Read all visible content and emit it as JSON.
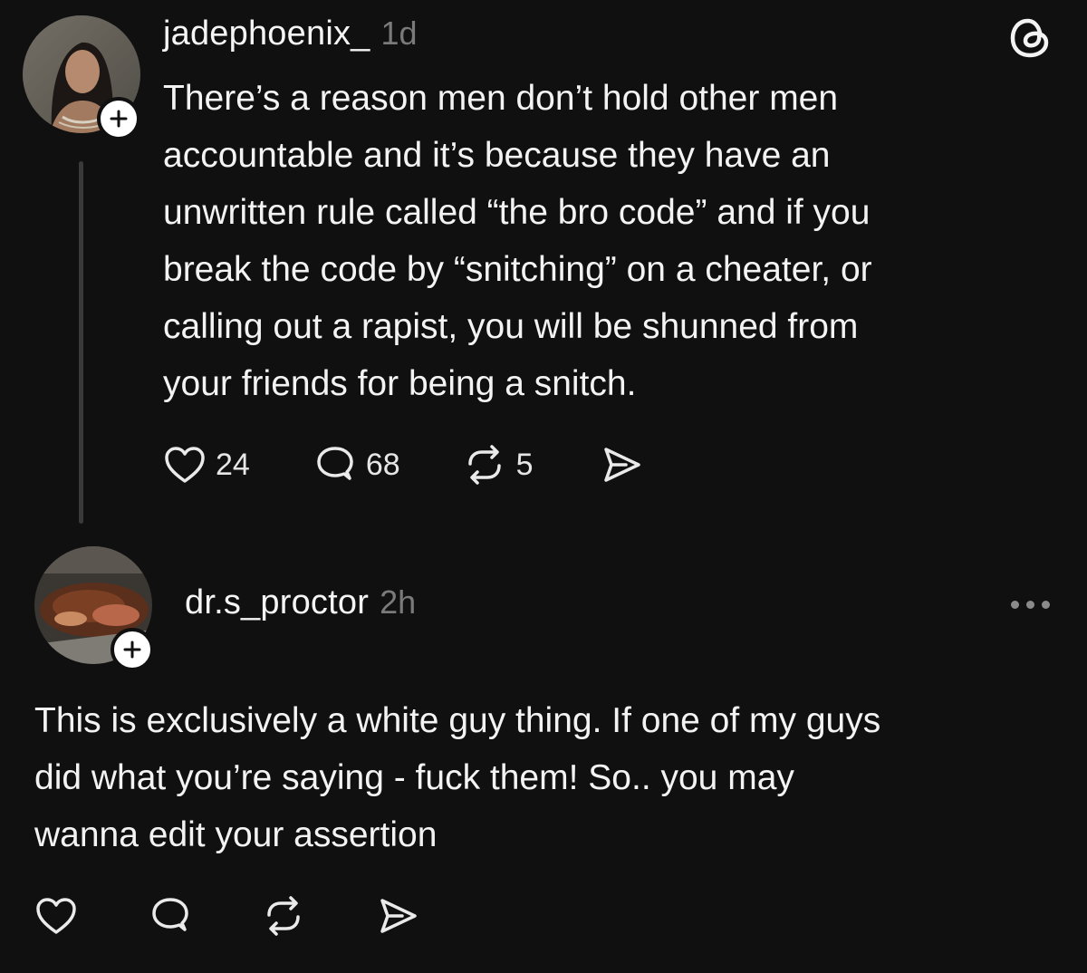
{
  "post": {
    "username": "jadephoenix_",
    "time": "1d",
    "text": "There’s a reason men don’t hold other men\naccountable and it’s because they have an\nunwritten rule called “the bro code” and if you\nbreak the code by “snitching” on a cheater, or\ncalling out a rapist, you will be shunned from\nyour friends for being a snitch.",
    "likes": "24",
    "replies": "68",
    "reposts": "5",
    "avatar_icon": "user-avatar-photo",
    "app_icon": "threads-logo-icon"
  },
  "reply": {
    "username": "dr.s_proctor",
    "time": "2h",
    "text": "This is exclusively a white guy thing.  If one of my guys\ndid what you’re saying - fuck them!  So.. you may\nwanna edit your assertion",
    "avatar_icon": "food-photo-avatar"
  },
  "colors": {
    "background": "#101010",
    "text": "#f3f3f3",
    "muted": "#7a7a7a",
    "thread_line": "#3a3a3a"
  }
}
